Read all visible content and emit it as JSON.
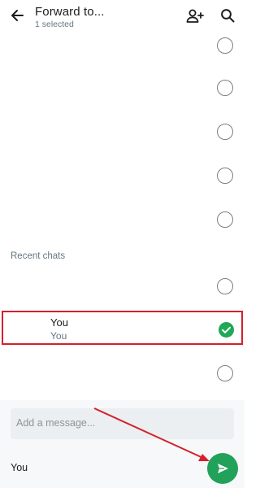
{
  "header": {
    "title": "Forward to...",
    "subtitle": "1 selected",
    "icons": {
      "back": "arrow-left-icon",
      "new_group": "add-person-icon",
      "search": "search-icon"
    }
  },
  "recent_chats": {
    "label": "Recent chats"
  },
  "selected_chat": {
    "name": "You",
    "subtitle": "You"
  },
  "message": {
    "placeholder": "Add a message..."
  },
  "footer": {
    "recipient": "You"
  },
  "colors": {
    "accent": "#21a15a",
    "highlight": "#d4202c",
    "secondary_text": "#667781"
  }
}
